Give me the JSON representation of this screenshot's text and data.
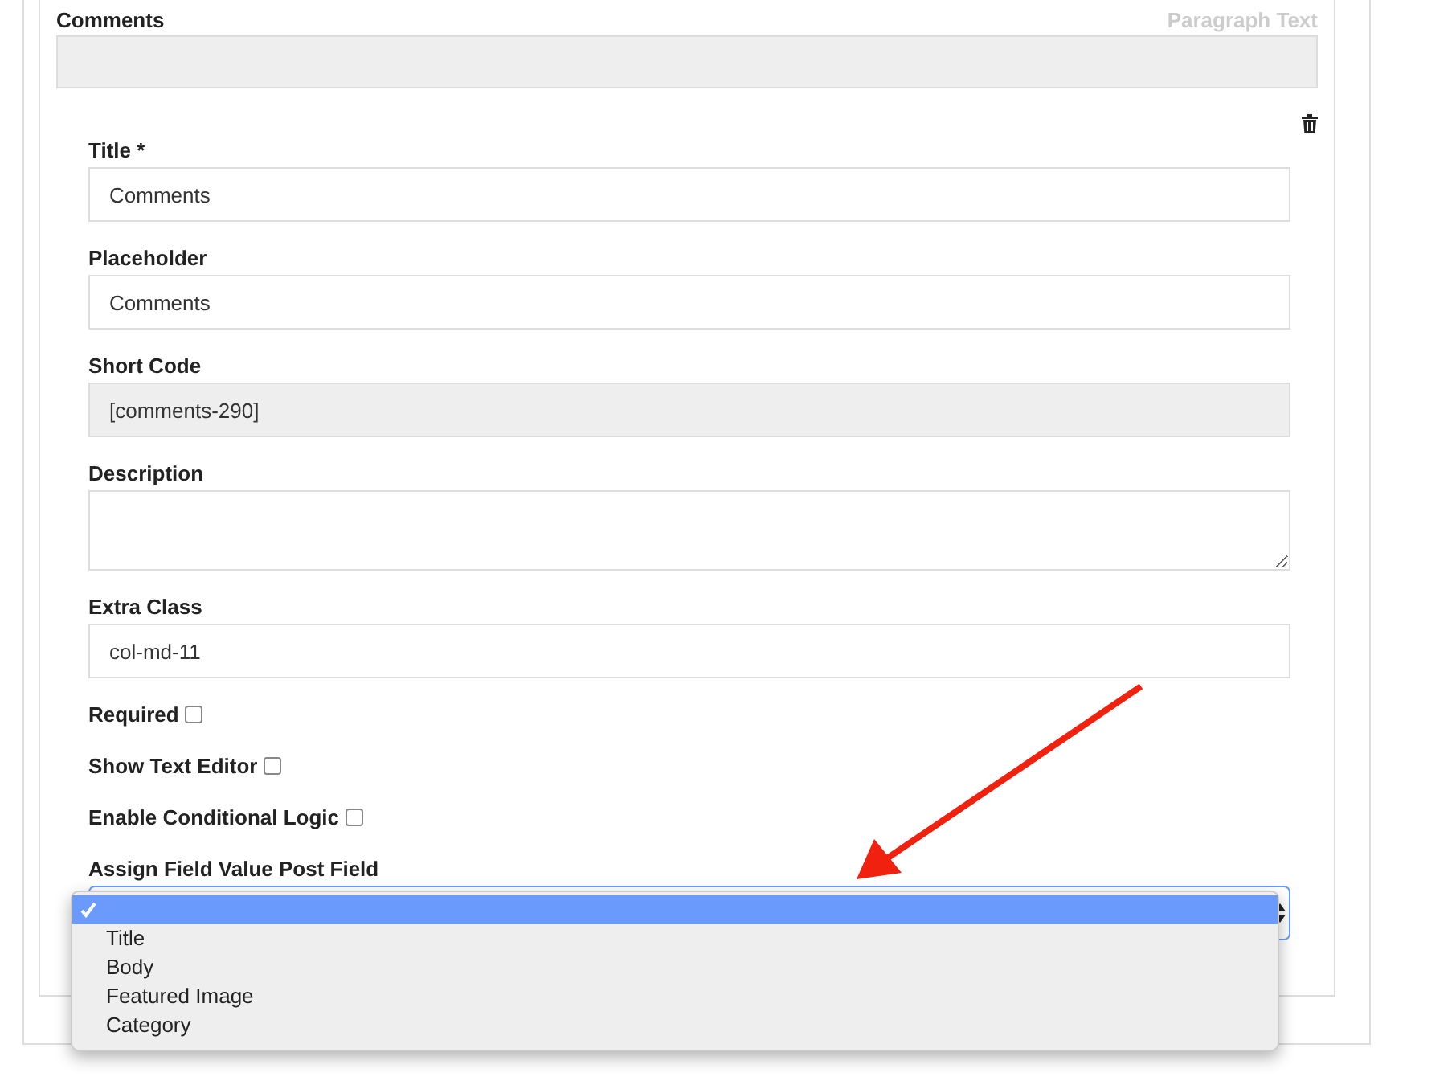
{
  "panel": {
    "title": "Comments",
    "type_label": "Paragraph Text"
  },
  "fields": [
    {
      "kind": "text",
      "label": "Title *",
      "value": "Comments"
    },
    {
      "kind": "text",
      "label": "Placeholder",
      "value": "Comments"
    },
    {
      "kind": "readonly",
      "label": "Short Code",
      "value": "[comments-290]"
    },
    {
      "kind": "textarea",
      "label": "Description"
    },
    {
      "kind": "text",
      "label": "Extra Class",
      "value": "col-md-11"
    },
    {
      "kind": "checkbox",
      "label": "Required",
      "checked": false
    },
    {
      "kind": "checkbox",
      "label": "Show Text Editor",
      "checked": false
    },
    {
      "kind": "checkbox",
      "label": "Enable Conditional Logic",
      "checked": false
    },
    {
      "kind": "select",
      "label": "Assign Field Value Post Field",
      "expanded": true,
      "options": [
        {
          "selected": true
        },
        {
          "label": "Title",
          "selected": false
        },
        {
          "label": "Body",
          "selected": false
        },
        {
          "label": "Featured Image",
          "selected": false
        },
        {
          "label": "Category",
          "selected": false
        }
      ]
    }
  ]
}
